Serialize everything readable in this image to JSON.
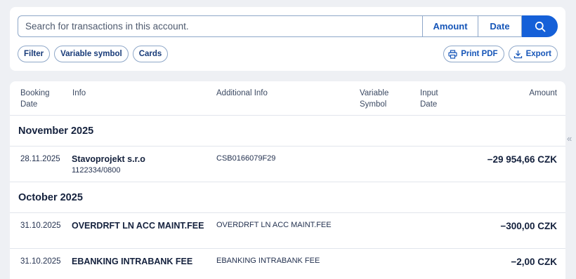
{
  "search": {
    "placeholder": "Search for transactions in this account.",
    "amount_label": "Amount",
    "date_label": "Date"
  },
  "chips": [
    {
      "label": "Filter"
    },
    {
      "label": "Variable symbol"
    },
    {
      "label": "Cards"
    }
  ],
  "actions": {
    "print_label": "Print PDF",
    "export_label": "Export"
  },
  "table": {
    "columns": {
      "booking_date": [
        "Booking",
        "Date"
      ],
      "info": "Info",
      "additional_info": "Additional Info",
      "variable_symbol": [
        "Variable",
        "Symbol"
      ],
      "input_date": [
        "Input",
        "Date"
      ],
      "amount": "Amount"
    },
    "groups": [
      {
        "month": "November 2025",
        "rows": [
          {
            "date": "28.11.2025",
            "name": "Stavoprojekt s.r.o",
            "sub": "1122334/0800",
            "additional": "CSB0166079F29",
            "amount": "−29 954,66 CZK"
          }
        ]
      },
      {
        "month": "October 2025",
        "rows": [
          {
            "date": "31.10.2025",
            "name": "OVERDRFT LN ACC MAINT.FEE",
            "sub": "",
            "additional": "OVERDRFT LN ACC MAINT.FEE",
            "amount": "−300,00 CZK"
          },
          {
            "date": "31.10.2025",
            "name": "EBANKING INTRABANK FEE",
            "sub": "",
            "additional": "EBANKING INTRABANK FEE",
            "amount": "−2,00 CZK"
          }
        ]
      }
    ]
  },
  "colors": {
    "primary": "#1560d8",
    "border": "#8ea7c8",
    "background": "#eef0f4"
  }
}
